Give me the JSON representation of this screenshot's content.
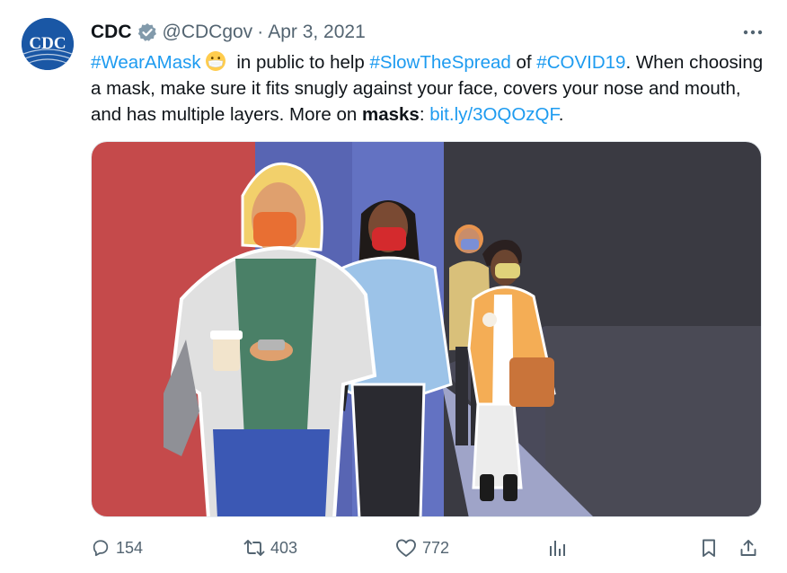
{
  "tweet": {
    "author_name": "CDC",
    "handle": "@CDCgov",
    "separator": "·",
    "date": "Apr 3, 2021",
    "avatar_text": "CDC",
    "text_parts": {
      "hashtag_wearamask": "#WearAMask",
      "part1": " in public to help ",
      "hashtag_slowthespread": "#SlowTheSpread",
      "part2": " of ",
      "hashtag_covid19": "#COVID19",
      "part3": ". When choosing a mask, make sure it fits snugly against your face, covers your nose and mouth, and has multiple layers. More on ",
      "bold_masks": "masks",
      "part4": ": ",
      "link": "bit.ly/3OQOzQF",
      "part5": "."
    },
    "media": {
      "description_icon": "people-wearing-masks-illustration"
    }
  },
  "actions": {
    "replies": "154",
    "retweets": "403",
    "likes": "772"
  },
  "colors": {
    "link": "#1d9bf0",
    "secondary": "#536471",
    "brand": "#1a57a5"
  }
}
